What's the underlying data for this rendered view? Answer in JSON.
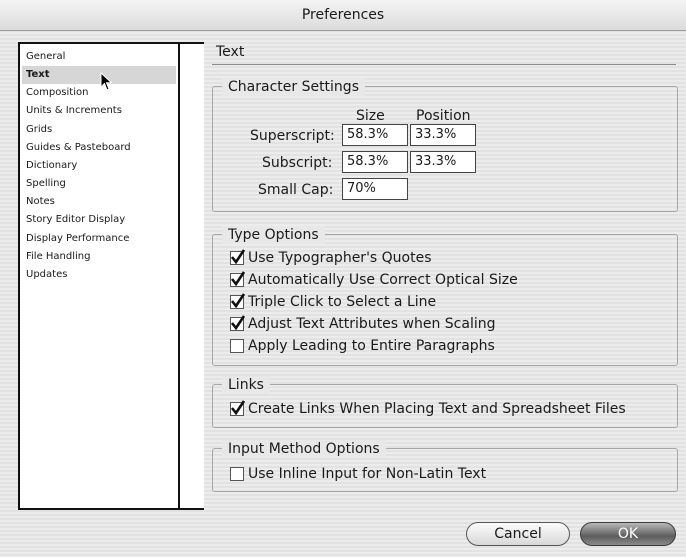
{
  "window": {
    "title": "Preferences"
  },
  "sidebar": {
    "items": [
      {
        "label": "General"
      },
      {
        "label": "Text",
        "selected": true
      },
      {
        "label": "Composition"
      },
      {
        "label": "Units & Increments"
      },
      {
        "label": "Grids"
      },
      {
        "label": "Guides & Pasteboard"
      },
      {
        "label": "Dictionary"
      },
      {
        "label": "Spelling"
      },
      {
        "label": "Notes"
      },
      {
        "label": "Story Editor Display"
      },
      {
        "label": "Display Performance"
      },
      {
        "label": "File Handling"
      },
      {
        "label": "Updates"
      }
    ]
  },
  "main": {
    "section_title": "Text",
    "character_settings": {
      "title": "Character Settings",
      "size_header": "Size",
      "position_header": "Position",
      "superscript_label": "Superscript:",
      "superscript_size": "58.3%",
      "superscript_position": "33.3%",
      "subscript_label": "Subscript:",
      "subscript_size": "58.3%",
      "subscript_position": "33.3%",
      "small_cap_label": "Small Cap:",
      "small_cap_value": "70%"
    },
    "type_options": {
      "title": "Type Options",
      "options": [
        {
          "label": "Use Typographer's Quotes",
          "checked": true
        },
        {
          "label": "Automatically Use Correct Optical Size",
          "checked": true
        },
        {
          "label": "Triple Click to Select a Line",
          "checked": true
        },
        {
          "label": "Adjust Text Attributes when Scaling",
          "checked": true
        },
        {
          "label": "Apply Leading to Entire Paragraphs",
          "checked": false
        }
      ]
    },
    "links": {
      "title": "Links",
      "option": {
        "label": "Create Links When Placing Text and Spreadsheet Files",
        "checked": true
      }
    },
    "input_method": {
      "title": "Input Method Options",
      "option": {
        "label": "Use Inline Input for Non-Latin Text",
        "checked": false
      }
    }
  },
  "footer": {
    "cancel_label": "Cancel",
    "ok_label": "OK"
  }
}
